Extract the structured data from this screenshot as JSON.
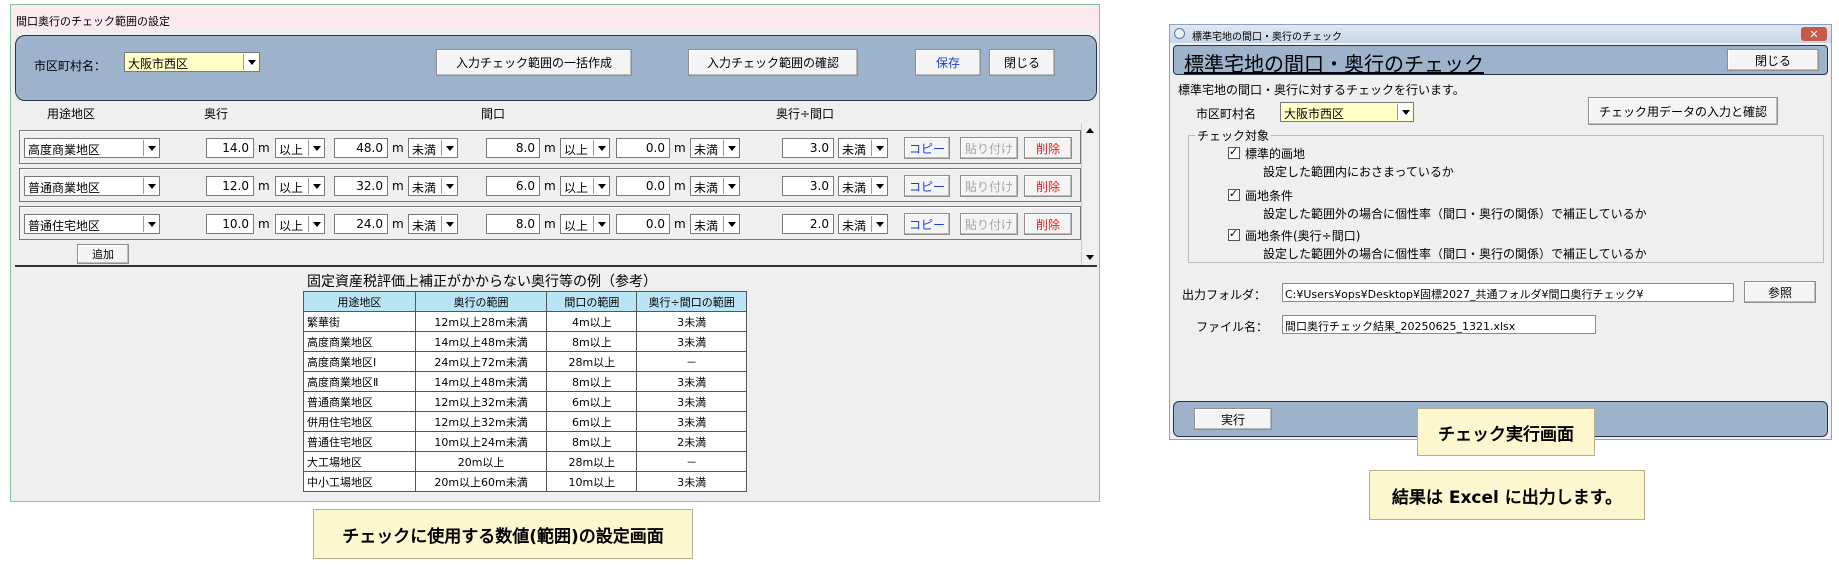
{
  "range_window": {
    "title": "間口奥行のチェック範囲の設定",
    "municipality_label": "市区町村名：",
    "municipality_value": "大阪市西区",
    "btn_bulk_create": "入力チェック範囲の一括作成",
    "btn_confirm": "入力チェック範囲の確認",
    "btn_save": "保存",
    "btn_close": "閉じる",
    "col_headers": [
      "用途地区",
      "奥行",
      "間口",
      "奥行÷間口"
    ],
    "unit": "m",
    "rows": [
      {
        "district": "高度商業地区",
        "depth_min": "14.0",
        "depth_min_op": "以上",
        "depth_max": "48.0",
        "depth_max_op": "未満",
        "frontage_min": "8.0",
        "frontage_min_op": "以上",
        "frontage_max": "0.0",
        "frontage_max_op": "未満",
        "ratio": "3.0",
        "ratio_op": "未満"
      },
      {
        "district": "普通商業地区",
        "depth_min": "12.0",
        "depth_min_op": "以上",
        "depth_max": "32.0",
        "depth_max_op": "未満",
        "frontage_min": "6.0",
        "frontage_min_op": "以上",
        "frontage_max": "0.0",
        "frontage_max_op": "未満",
        "ratio": "3.0",
        "ratio_op": "未満"
      },
      {
        "district": "普通住宅地区",
        "depth_min": "10.0",
        "depth_min_op": "以上",
        "depth_max": "24.0",
        "depth_max_op": "未満",
        "frontage_min": "8.0",
        "frontage_min_op": "以上",
        "frontage_max": "0.0",
        "frontage_max_op": "未満",
        "ratio": "2.0",
        "ratio_op": "未満"
      }
    ],
    "btn_copy": "コピー",
    "btn_paste": "貼り付け",
    "btn_delete": "削除",
    "btn_add": "追加",
    "ref_table_title": "固定資産税評価上補正がかからない奥行等の例（参考）",
    "ref_table_headers": [
      "用途地区",
      "奥行の範囲",
      "間口の範囲",
      "奥行÷間口の範囲"
    ],
    "ref_table_rows": [
      [
        "繁華街",
        "12m以上28m未満",
        "4m以上",
        "3未満"
      ],
      [
        "高度商業地区",
        "14m以上48m未満",
        "8m以上",
        "3未満"
      ],
      [
        "高度商業地区Ⅰ",
        "24m以上72m未満",
        "28m以上",
        "－"
      ],
      [
        "高度商業地区Ⅱ",
        "14m以上48m未満",
        "8m以上",
        "3未満"
      ],
      [
        "普通商業地区",
        "12m以上32m未満",
        "6m以上",
        "3未満"
      ],
      [
        "併用住宅地区",
        "12m以上32m未満",
        "6m以上",
        "3未満"
      ],
      [
        "普通住宅地区",
        "10m以上24m未満",
        "8m以上",
        "2未満"
      ],
      [
        "大工場地区",
        "20m以上",
        "28m以上",
        "－"
      ],
      [
        "中小工場地区",
        "20m以上60m未満",
        "10m以上",
        "3未満"
      ]
    ]
  },
  "check_window": {
    "title": "標準宅地の間口・奥行のチェック",
    "heading": "標準宅地の間口・奥行のチェック",
    "btn_close": "閉じる",
    "description": "標準宅地の間口・奥行に対するチェックを行います。",
    "municipality_label": "市区町村名",
    "municipality_value": "大阪市西区",
    "btn_data_input": "チェック用データの入力と確認",
    "group_label": "チェック対象",
    "checks": [
      {
        "label": "標準的画地",
        "desc": "設定した範囲内におさまっているか",
        "checked": true
      },
      {
        "label": "画地条件",
        "desc": "設定した範囲外の場合に個性率（間口・奥行の関係）で補正しているか",
        "checked": true
      },
      {
        "label": "画地条件(奥行÷間口)",
        "desc": "設定した範囲外の場合に個性率（間口・奥行の関係）で補正しているか",
        "checked": true
      }
    ],
    "output_folder_label": "出力フォルダ：",
    "output_folder_value": "C:¥Users¥ops¥Desktop¥固標2027_共通フォルダ¥間口奥行チェック¥",
    "btn_browse": "参照",
    "filename_label": "ファイル名：",
    "filename_value": "間口奥行チェック結果_20250625_1321.xlsx",
    "btn_run": "実行"
  },
  "captions": {
    "settings_screen": "チェックに使用する数値(範囲)の設定画面",
    "run_screen": "チェック実行画面",
    "excel_output": "結果は Excel に出力します。"
  },
  "colors": {
    "panel_blue": "#9db3cc",
    "caption_bg": "#fdf7cf",
    "link_blue": "#1a3fd8",
    "delete_red": "#e02020",
    "header_cyan": "#b9e4f5"
  }
}
